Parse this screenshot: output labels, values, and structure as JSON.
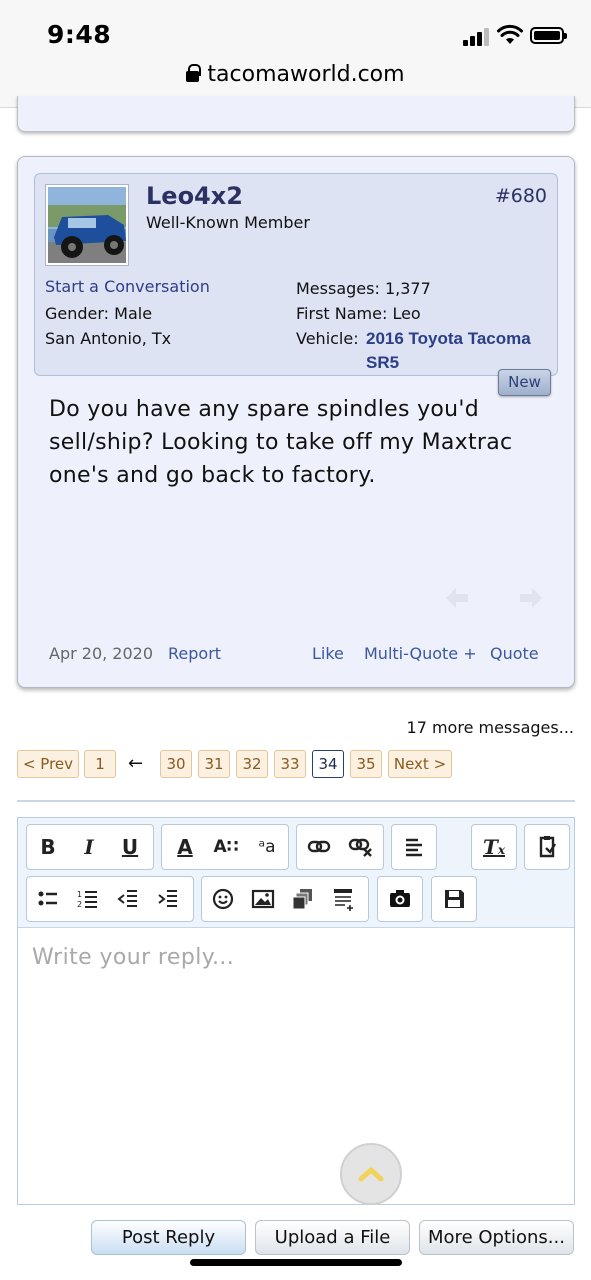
{
  "status_bar": {
    "time": "9:48",
    "url": "tacomaworld.com"
  },
  "post": {
    "username": "Leo4x2",
    "user_title": "Well-Known Member",
    "post_number": "#680",
    "start_conversation": "Start a Conversation",
    "gender": "Gender:  Male",
    "location": "San Antonio, Tx",
    "messages": "Messages:  1,377",
    "first_name": "First Name:  Leo",
    "vehicle_label": "Vehicle:",
    "vehicle_value": "2016 Toyota Tacoma SR5",
    "new_badge": "New",
    "body": "Do you have any spare spindles you'd sell/ship? Looking to take off my Maxtrac one's and go back to factory.",
    "date": "Apr 20, 2020",
    "report": "Report",
    "like": "Like",
    "multi_quote": "Multi-Quote +",
    "quote": "Quote"
  },
  "thread": {
    "more_messages": "17 more messages..."
  },
  "pagination": {
    "prev": "< Prev",
    "first": "1",
    "ellipsis_arrow": "←",
    "pages": [
      "30",
      "31",
      "32",
      "33",
      "34",
      "35"
    ],
    "current": "34",
    "next": "Next >"
  },
  "editor": {
    "placeholder": "Write your reply...",
    "toolbar_icons": [
      "bold-icon",
      "italic-icon",
      "underline-icon",
      "font-color-icon",
      "font-size-icon",
      "font-family-icon",
      "link-icon",
      "unlink-icon",
      "align-icon",
      "remove-format-icon",
      "paste-icon",
      "bullet-list-icon",
      "numbered-list-icon",
      "outdent-icon",
      "indent-icon",
      "smiley-icon",
      "image-icon",
      "media-icon",
      "quote-insert-icon",
      "camera-icon",
      "save-draft-icon"
    ]
  },
  "actions": {
    "post_reply": "Post Reply",
    "upload_file": "Upload a File",
    "more_options": "More Options..."
  }
}
